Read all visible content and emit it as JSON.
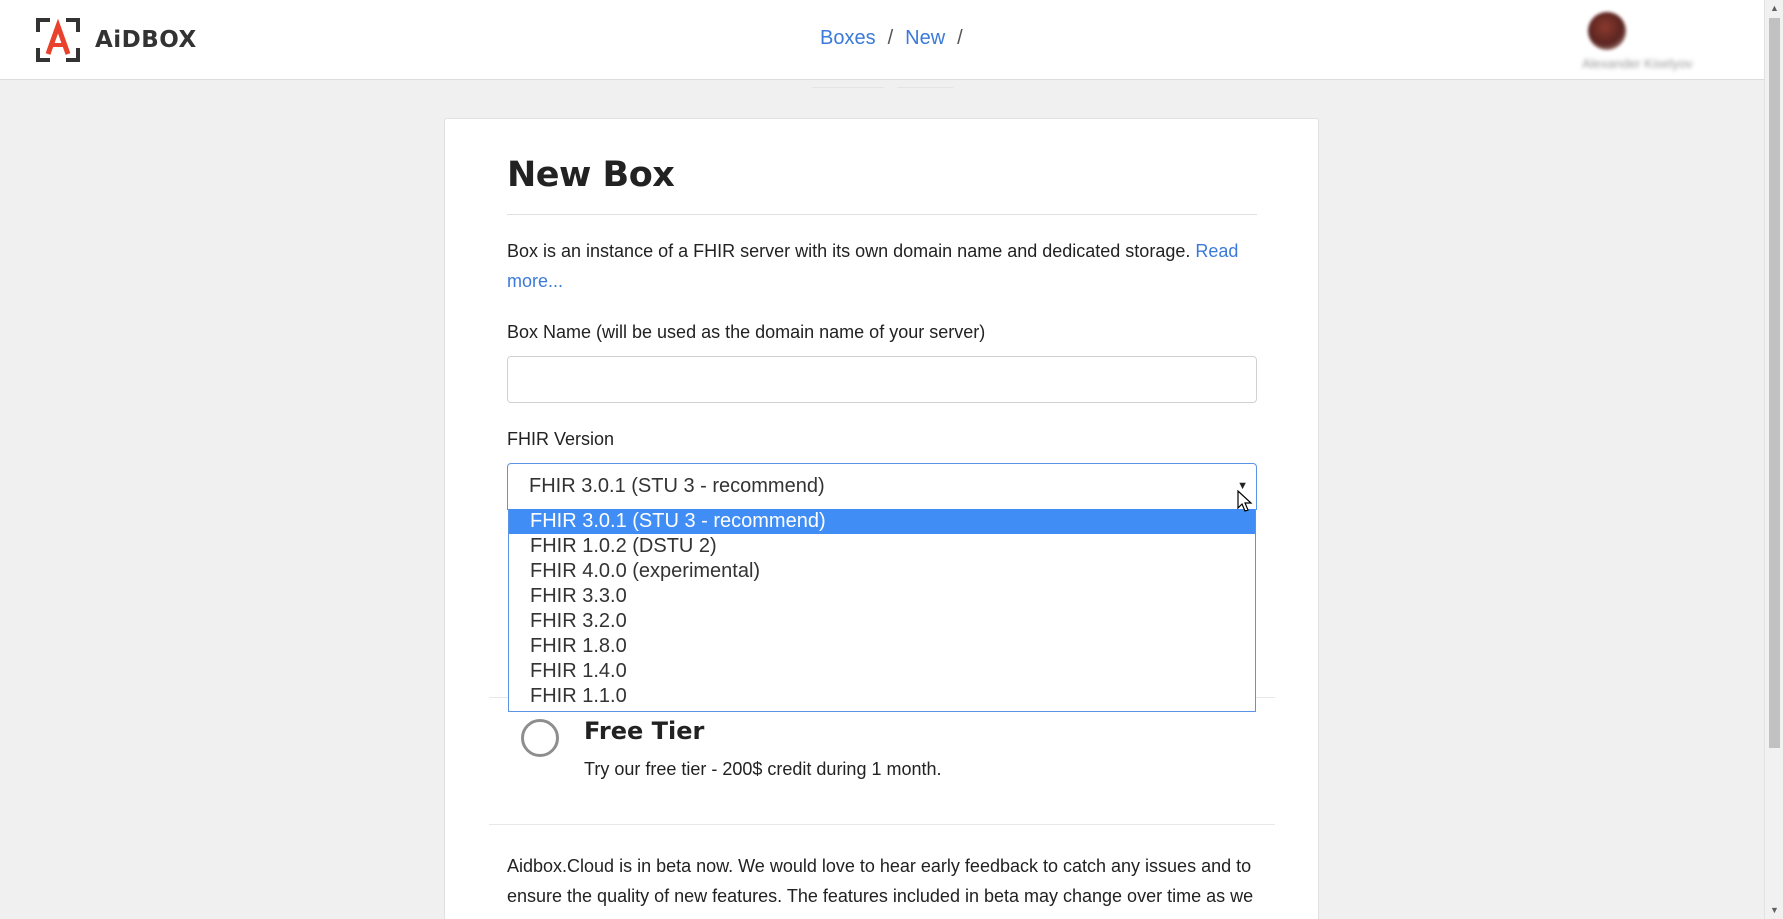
{
  "header": {
    "logo_text": "AiDBOX",
    "breadcrumbs": [
      {
        "label": "Boxes"
      },
      {
        "label": "New"
      }
    ],
    "separator": "/",
    "user_name": "Alexander Kiselyov"
  },
  "card": {
    "title": "New Box",
    "intro_text": "Box is an instance of a FHIR server with its own domain name and dedicated storage.",
    "read_more": "Read more...",
    "box_name_label": "Box Name (will be used as the domain name of your server)",
    "box_name_value": "",
    "fhir_label": "FHIR Version",
    "fhir_selected": "FHIR 3.0.1 (STU 3 - recommend)",
    "fhir_options": [
      "FHIR 3.0.1 (STU 3 - recommend)",
      "FHIR 1.0.2 (DSTU 2)",
      "FHIR 4.0.0 (experimental)",
      "FHIR 3.3.0",
      "FHIR 3.2.0",
      "FHIR 1.8.0",
      "FHIR 1.4.0",
      "FHIR 1.1.0"
    ],
    "tier_title": "Free Tier",
    "tier_desc": "Try our free tier - 200$ credit during 1 month.",
    "beta_text": "Aidbox.Cloud is in beta now. We would love to hear early feedback to catch any issues and to ensure the quality of new features. The features included in beta may change over time as we"
  },
  "colors": {
    "link": "#3b7ad8",
    "selected_option": "#3f8df5",
    "logo_accent": "#e8412c"
  },
  "icons": [
    "aidbox-logo-icon",
    "dropdown-arrow-icon",
    "radio-icon",
    "cursor-icon"
  ]
}
